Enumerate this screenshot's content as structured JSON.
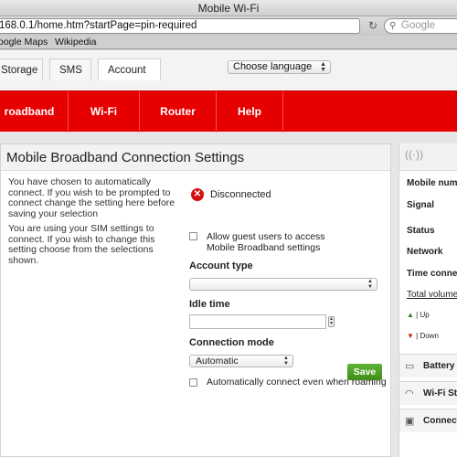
{
  "window": {
    "title": "Mobile Wi-Fi"
  },
  "browser": {
    "url": "168.0.1/home.htm?startPage=pin-required",
    "search_placeholder": "Google",
    "bookmarks": [
      "oogle Maps",
      "Wikipedia"
    ]
  },
  "top_tabs": [
    "Storage",
    "SMS",
    "Account"
  ],
  "language": {
    "value": "Choose language"
  },
  "main_nav": [
    "roadband",
    "Wi-Fi",
    "Router",
    "Help"
  ],
  "panel": {
    "title": "Mobile Broadband Connection Settings",
    "info1": "You have chosen to automatically connect. If you wish to be prompted to connect change the setting here before saving your selection",
    "info2": "You are using your SIM settings to connect. If you wish to change this setting choose from the selections shown.",
    "status_text": "Disconnected",
    "guest_label": "Allow guest users to access Mobile Broadband settings",
    "guest_checked": false,
    "account_type_label": "Account type",
    "account_type_value": "",
    "idle_time_label": "Idle time",
    "idle_time_value": "",
    "connection_mode_label": "Connection mode",
    "connection_mode_value": "Automatic",
    "roaming_label": "Automatically connect even when roaming",
    "roaming_checked": false,
    "save_label": "Save"
  },
  "sidebar": {
    "rows": [
      "Mobile numb",
      "Signal",
      "Status",
      "Network",
      "Time connec"
    ],
    "total_volume": "Total volume",
    "up_label": "| Up",
    "down_label": "| Down",
    "blocks": [
      "Battery",
      "Wi-Fi Sta",
      "Connect"
    ]
  },
  "colors": {
    "brand_red": "#e60000",
    "save_green": "#4a9d22"
  }
}
